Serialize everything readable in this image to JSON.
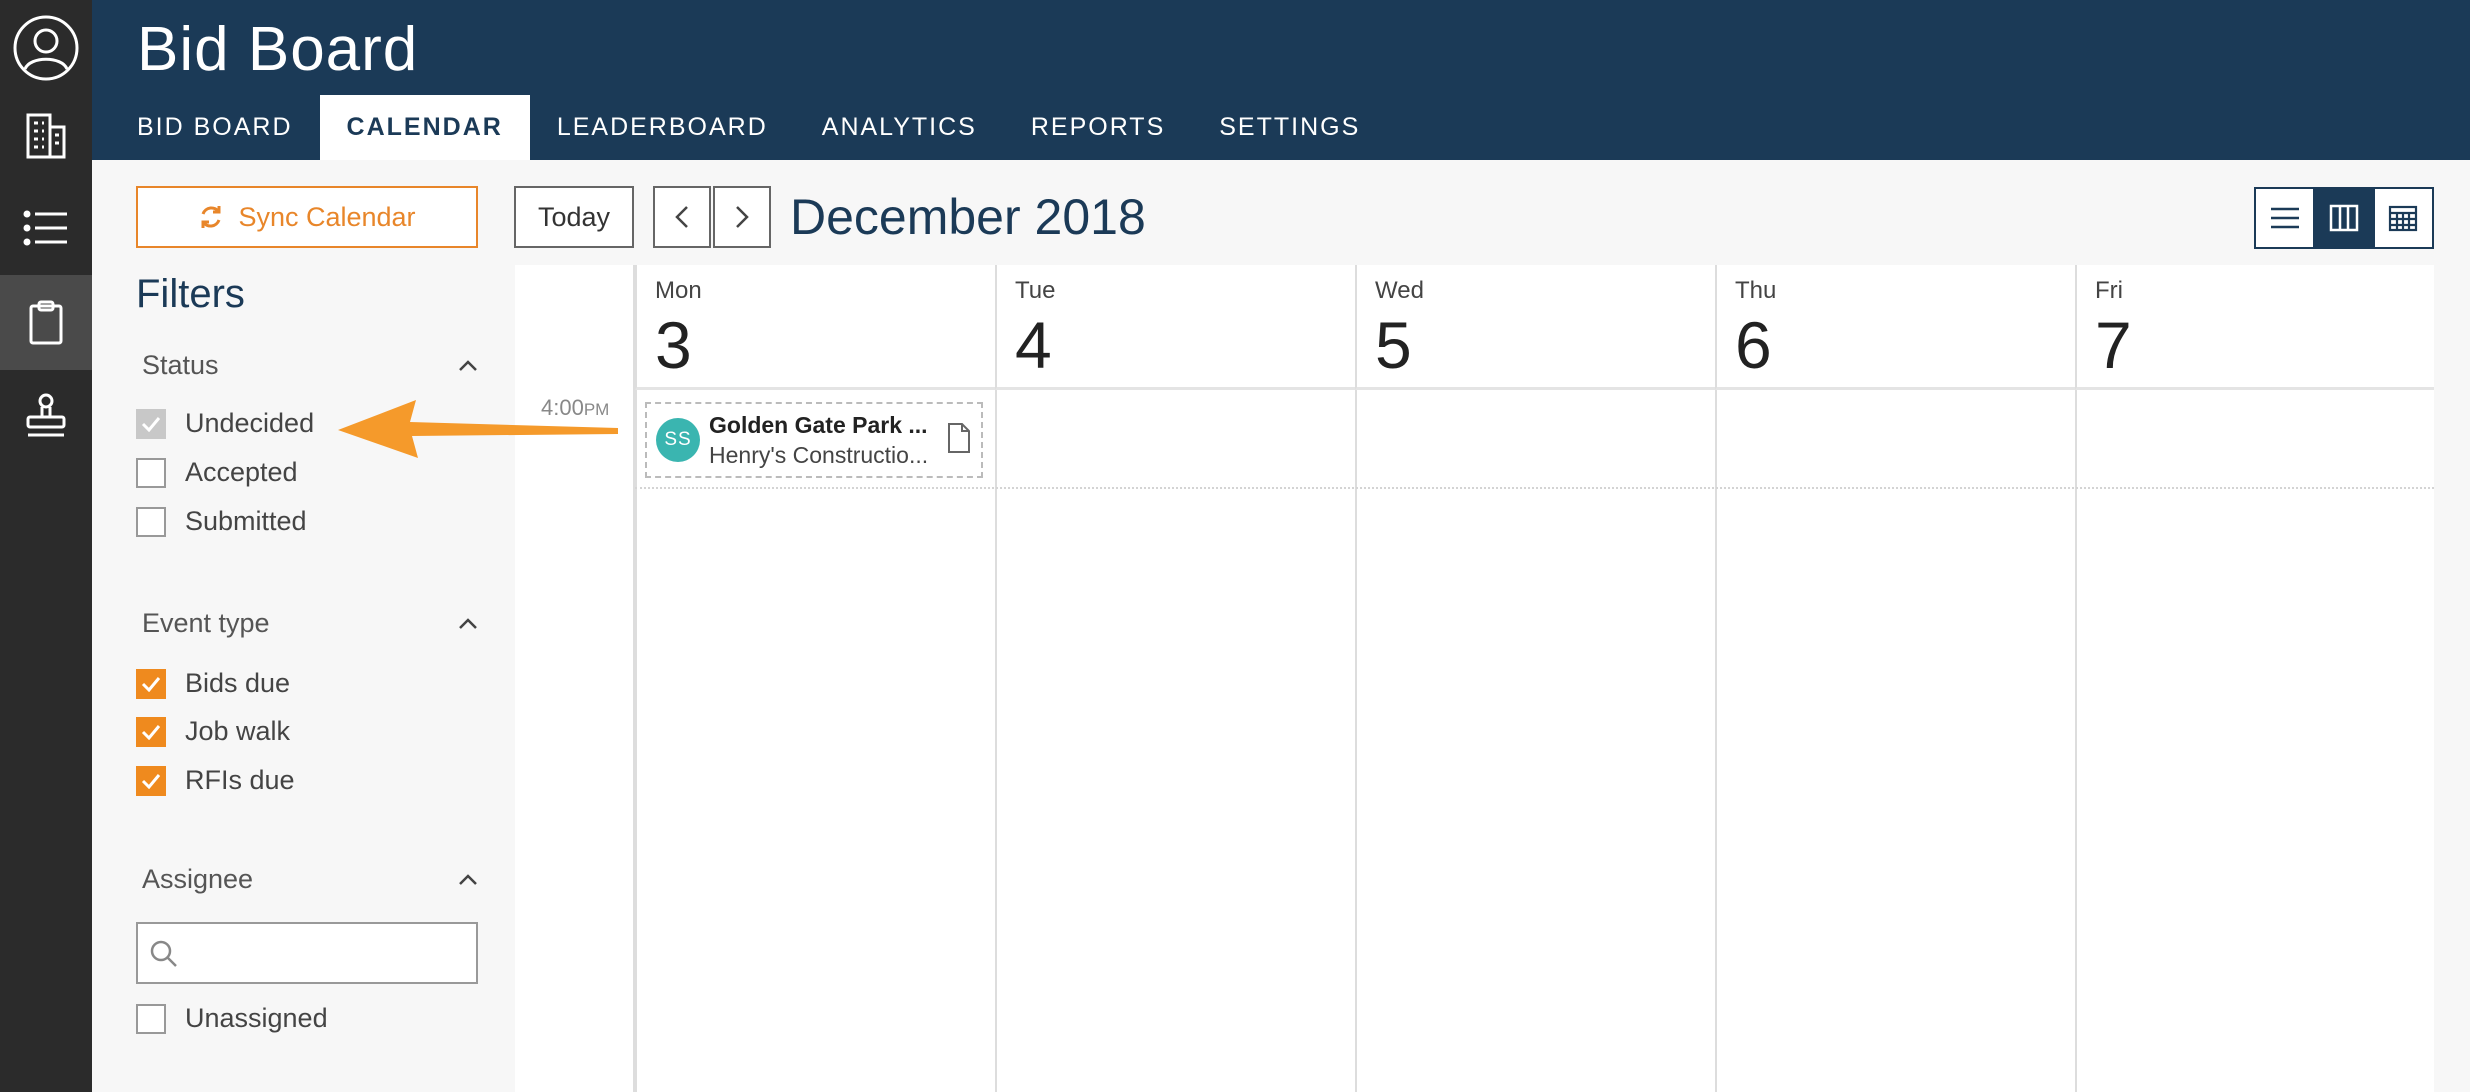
{
  "header": {
    "title": "Bid Board"
  },
  "tabs": [
    {
      "label": "BID BOARD"
    },
    {
      "label": "CALENDAR"
    },
    {
      "label": "LEADERBOARD"
    },
    {
      "label": "ANALYTICS"
    },
    {
      "label": "REPORTS"
    },
    {
      "label": "SETTINGS"
    }
  ],
  "active_tab": "CALENDAR",
  "rail": {
    "items": [
      "user-circle-icon",
      "building-icon",
      "list-icon",
      "clipboard-icon",
      "stamp-icon"
    ],
    "active_item": "clipboard-icon"
  },
  "filters": {
    "sync_label": "Sync Calendar",
    "title": "Filters",
    "status": {
      "label": "Status",
      "options": [
        {
          "label": "Undecided",
          "checked": true,
          "disabled": true
        },
        {
          "label": "Accepted",
          "checked": false
        },
        {
          "label": "Submitted",
          "checked": false
        }
      ]
    },
    "event_type": {
      "label": "Event type",
      "options": [
        {
          "label": "Bids due",
          "checked": true
        },
        {
          "label": "Job walk",
          "checked": true
        },
        {
          "label": "RFIs due",
          "checked": true
        }
      ]
    },
    "assignee": {
      "label": "Assignee",
      "search_placeholder": "",
      "options": [
        {
          "label": "Unassigned",
          "checked": false
        }
      ]
    }
  },
  "calendar": {
    "today_label": "Today",
    "month_title": "December 2018",
    "view_modes": [
      "list-icon",
      "week-icon",
      "month-icon"
    ],
    "active_view": "week-icon",
    "days": [
      {
        "name": "Mon",
        "num": "3"
      },
      {
        "name": "Tue",
        "num": "4"
      },
      {
        "name": "Wed",
        "num": "5"
      },
      {
        "name": "Thu",
        "num": "6"
      },
      {
        "name": "Fri",
        "num": "7"
      }
    ],
    "time_label": "4:00",
    "time_suffix": "PM",
    "event": {
      "initials": "SS",
      "title": "Golden Gate Park ...",
      "subtitle": "Henry's Constructio...",
      "avatar_color": "#3ab5b0"
    }
  },
  "colors": {
    "header_bg": "#1b3a57",
    "rail_bg": "#2b2b2b",
    "accent": "#ef8a1e"
  }
}
